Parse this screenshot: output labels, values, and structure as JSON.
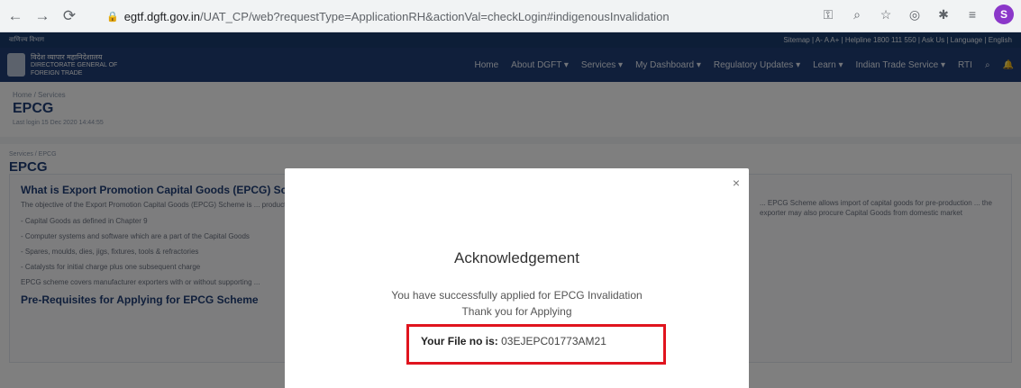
{
  "browser": {
    "url_host": "egtf.dgft.gov.in",
    "url_path": "/UAT_CP/web?requestType=ApplicationRH&actionVal=checkLogin#indigenousInvalidation",
    "profile_initial": "S"
  },
  "site": {
    "top_strip_left": "वाणिज्य विभाग",
    "top_strip_right": "Sitemap | A- A A+ | Helpline 1800 111 550 | Ask Us | Language | English",
    "brand_hindi": "विदेश व्यापार महानिदेशालय",
    "brand_line1": "DIRECTORATE GENERAL OF",
    "brand_line2": "FOREIGN TRADE",
    "nav": [
      "Home",
      "About DGFT ▾",
      "Services ▾",
      "My Dashboard ▾",
      "Regulatory Updates ▾",
      "Learn ▾",
      "Indian Trade Service ▾",
      "RTI"
    ]
  },
  "page": {
    "breadcrumb_top": "Home / Services",
    "title": "EPCG",
    "last_login": "Last login 15 Dec 2020 14:44:55",
    "breadcrumb_section": "Services / EPCG",
    "section_title": "EPCG",
    "card_heading": "What is Export Promotion Capital Goods (EPCG) Scheme",
    "card_para": "The objective of the Export Promotion Capital Goods (EPCG) Scheme is ... production and post-production at zero customs duty. Capital goods ... in accordance with provisions of paragraph 5.07 of FTP. Capital goods ...",
    "card_para_right": "... EPCG Scheme allows import of capital goods for pre-production ... the exporter may also procure Capital Goods from domestic market",
    "items": [
      "- Capital Goods as defined in Chapter 9",
      "- Computer systems and software which are a part of the Capital Goods",
      "- Spares, moulds, dies, jigs, fixtures, tools & refractories",
      "- Catalysts for initial charge plus one subsequent charge"
    ],
    "card_note": "EPCG scheme covers manufacturer exporters with or without supporting ...",
    "card_subheading": "Pre-Requisites for Applying for EPCG Scheme"
  },
  "modal": {
    "close_symbol": "×",
    "title": "Acknowledgement",
    "message_line1": "You have successfully applied for EPCG Invalidation",
    "message_line2": "Thank you for Applying",
    "file_label": "Your File no is:",
    "file_number": "03EJEPC01773AM21"
  },
  "colors": {
    "header_navy": "#203f77",
    "highlight_red": "#e0141e",
    "profile_purple": "#8b37c9"
  }
}
